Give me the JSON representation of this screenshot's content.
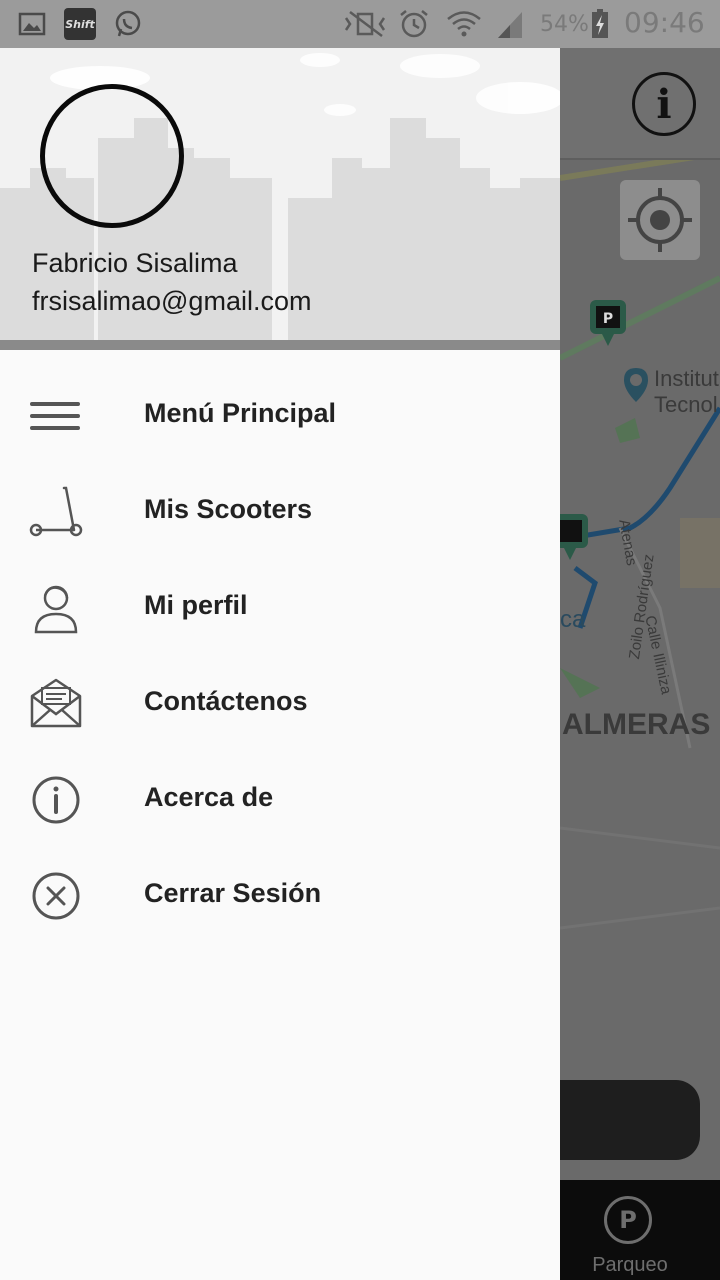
{
  "status_bar": {
    "battery_text": "54%",
    "time": "09:46",
    "app_badge": "Shift"
  },
  "drawer": {
    "user_name": "Fabricio Sisalima",
    "user_email": "frsisalimao@gmail.com",
    "menu": [
      {
        "label": "Menú Principal",
        "icon": "hamburger-menu-icon"
      },
      {
        "label": "Mis Scooters",
        "icon": "scooter-icon"
      },
      {
        "label": "Mi perfil",
        "icon": "user-profile-icon"
      },
      {
        "label": "Contáctenos",
        "icon": "envelope-icon"
      },
      {
        "label": "Acerca de",
        "icon": "info-circle-icon"
      },
      {
        "label": "Cerrar Sesión",
        "icon": "close-circle-icon"
      }
    ]
  },
  "map": {
    "labels": {
      "institute_line1": "Institut",
      "institute_line2": "Tecnol",
      "street_atenas": "Atenas",
      "street_zoilo": "Zoilo Rodríguez",
      "street_illiniza": "Calle Illiniza",
      "area_ca": "ca",
      "area_palmeras": "ALMERAS"
    },
    "info_button": "i",
    "bottom_nav": {
      "parking_label": "Parqueo",
      "parking_glyph": "P"
    }
  },
  "colors": {
    "drawer_bg": "#fafafa",
    "header_bg": "#f2f2f2",
    "divider": "#8a8a8a",
    "text": "#222222",
    "overlay": "#6a6a6a",
    "route": "#1f4a6e"
  }
}
